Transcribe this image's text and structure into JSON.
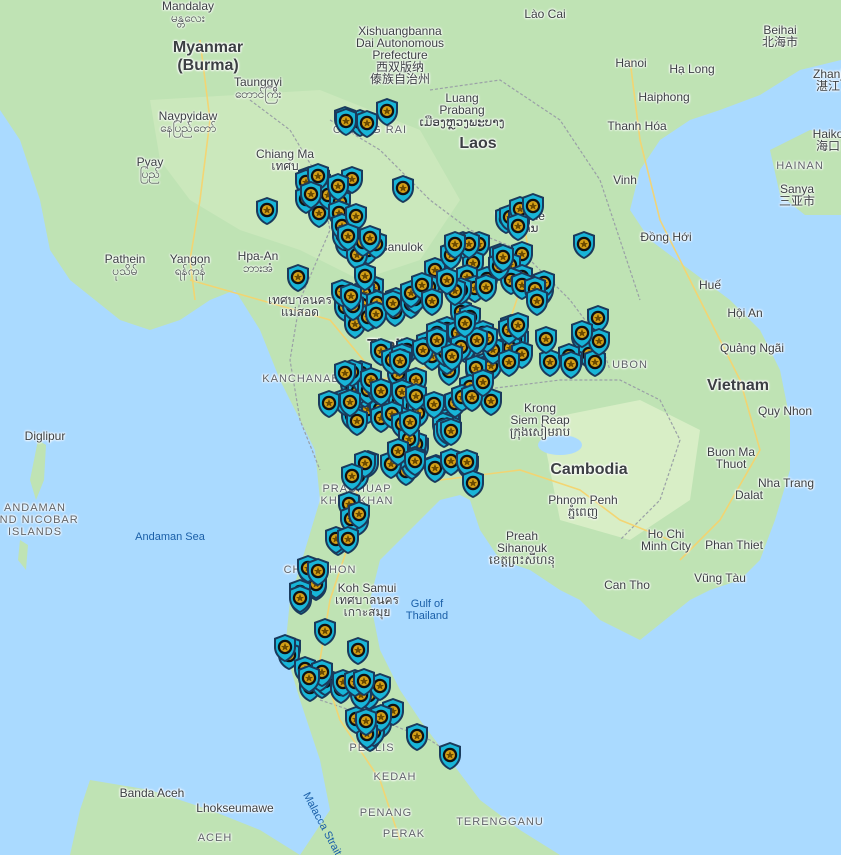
{
  "map": {
    "country_labels": [
      {
        "key": "myanmar",
        "text": "Myanmar\n(Burma)"
      },
      {
        "key": "laos",
        "text": "Laos"
      },
      {
        "key": "thailand",
        "text": "Thailand"
      },
      {
        "key": "cambodia",
        "text": "Cambodia"
      },
      {
        "key": "vietnam",
        "text": "Vietnam"
      }
    ],
    "city_labels": [
      {
        "key": "mandalay",
        "text": "Mandalay\nမန္တလေး"
      },
      {
        "key": "taunggyi",
        "text": "Taunggyi\nတောင်ကြီး"
      },
      {
        "key": "naypyidaw",
        "text": "Naypyidaw\nနေပြည်တော်"
      },
      {
        "key": "pyay",
        "text": "Pyay\nပြည်"
      },
      {
        "key": "pathein",
        "text": "Pathein\nပုသိမ်"
      },
      {
        "key": "yangon",
        "text": "Yangon\nရန်ကုန်"
      },
      {
        "key": "hpa_an",
        "text": "Hpa-An\nဘားအံ"
      },
      {
        "key": "xishuangbanna",
        "text": "Xishuangbanna\nDai Autonomous\nPrefecture\n西双版纳\n傣族自治州"
      },
      {
        "key": "luang_prabang",
        "text": "Luang\nPrabang\nເມືອງຫຼວງພະບາງ"
      },
      {
        "key": "vientiane",
        "text": "Vientiane\nວຽງຈັນ"
      },
      {
        "key": "lao_cai",
        "text": "Lào Cai"
      },
      {
        "key": "hanoi",
        "text": "Hanoi"
      },
      {
        "key": "ha_long",
        "text": "Hạ Long"
      },
      {
        "key": "haiphong",
        "text": "Haiphong"
      },
      {
        "key": "thanh_hoa",
        "text": "Thanh Hóa"
      },
      {
        "key": "vinh",
        "text": "Vinh"
      },
      {
        "key": "dong_hoi",
        "text": "Đồng Hới"
      },
      {
        "key": "hue",
        "text": "Huế"
      },
      {
        "key": "hoi_an",
        "text": "Hội An"
      },
      {
        "key": "quang_ngai",
        "text": "Quảng Ngãi"
      },
      {
        "key": "quy_nhon",
        "text": "Quy Nhon"
      },
      {
        "key": "buon_ma_thuot",
        "text": "Buon Ma\nThuot"
      },
      {
        "key": "nha_trang",
        "text": "Nha Trang"
      },
      {
        "key": "dalat",
        "text": "Dalat"
      },
      {
        "key": "phan_thiet",
        "text": "Phan Thiet"
      },
      {
        "key": "ho_chi_minh",
        "text": "Ho Chi\nMinh City"
      },
      {
        "key": "vung_tau",
        "text": "Vũng Tàu"
      },
      {
        "key": "can_tho",
        "text": "Can Tho"
      },
      {
        "key": "phnom_penh",
        "text": "Phnom Penh\nភ្នំពេញ"
      },
      {
        "key": "krong_siem_reap",
        "text": "Krong\nSiem Reap\nក្រុងសៀមរាប"
      },
      {
        "key": "preah_sihanouk",
        "text": "Preah\nSihanouk\nខេត្តព្រះសីហនុ"
      },
      {
        "key": "beijing",
        "text": "Beihai\n北海市"
      },
      {
        "key": "zhanjiang",
        "text": "Zhanj\n湛江"
      },
      {
        "key": "haikou",
        "text": "Haiko\n海口"
      },
      {
        "key": "hainan",
        "text": "HAINAN"
      },
      {
        "key": "sanya",
        "text": "Sanya\n三亚市"
      },
      {
        "key": "chiang_mai",
        "text": "Chiang Ma\nเทศบ"
      },
      {
        "key": "koh_samui",
        "text": "Koh Samui\nเทศบาลนคร\nเกาะสมุย"
      },
      {
        "key": "banda_aceh",
        "text": "Banda Aceh"
      },
      {
        "key": "lhokseumawe",
        "text": "Lhokseumawe"
      },
      {
        "key": "diglipur",
        "text": "Diglipur"
      },
      {
        "key": "kanchanaburi",
        "text": "KANCHANABURI"
      },
      {
        "key": "prachuap",
        "text": "PRACHUAP\nKHIRI KHAN"
      },
      {
        "key": "chumphon",
        "text": "CHUMPHON"
      },
      {
        "key": "perlis",
        "text": "PERLIS"
      },
      {
        "key": "kedah",
        "text": "KEDAH"
      },
      {
        "key": "penang",
        "text": "PENANG"
      },
      {
        "key": "perak",
        "text": "PERAK"
      },
      {
        "key": "terengganu",
        "text": "TERENGGANU"
      },
      {
        "key": "aceh",
        "text": "ACEH"
      },
      {
        "key": "andaman_nicobar",
        "text": "ANDAMAN\nAND NICOBAR\nISLANDS"
      },
      {
        "key": "chiang_rai",
        "text": "CHIANG RAI"
      },
      {
        "key": "phitsanulok",
        "text": "Phitsanulok"
      },
      {
        "key": "mae_sot",
        "text": "เทศบาลนคร\nแม่สอด"
      },
      {
        "key": "ubon",
        "text": "UBON"
      }
    ],
    "sea_labels": [
      {
        "key": "andaman_sea",
        "text": "Andaman Sea"
      },
      {
        "key": "gulf_of_thailand",
        "text": "Gulf of\nThailand"
      },
      {
        "key": "malacca",
        "text": "Malacca Strait"
      }
    ],
    "marker_icon": "police-badge-icon",
    "marker_count": 260,
    "colors": {
      "water": "#aadaff",
      "land": "#bfe3b4",
      "land_light": "#d8eec6",
      "border": "#9aa0a6",
      "road": "#f7d36b",
      "marker_outer": "#1a3a5c",
      "marker_ring": "#18b5d8",
      "marker_gold": "#d4a017"
    }
  }
}
